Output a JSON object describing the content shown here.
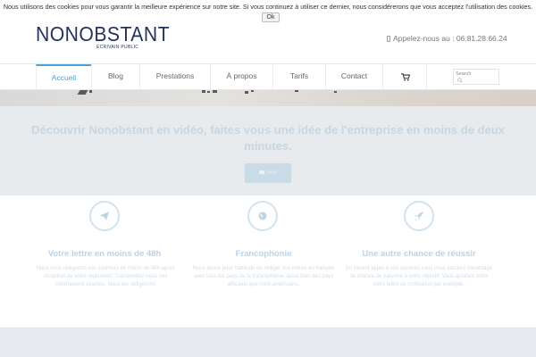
{
  "cookie": {
    "text": "Nous utilisons des cookies pour vous garantir la meilleure expérience sur notre site. Si vous continuez à utiliser ce dernier, nous considérerons que vous acceptez l'utilisation des cookies.",
    "ok_label": "Ok"
  },
  "header": {
    "logo": "NONOBSTANT",
    "logo_sub": "ÉCRIVAIN PUBLIC",
    "phone": "Appelez-nous au : 06.81.28.66.24"
  },
  "nav": {
    "items": [
      {
        "label": "Accueil"
      },
      {
        "label": "Blog"
      },
      {
        "label": "Prestations"
      },
      {
        "label": "À propos"
      },
      {
        "label": "Tarifs"
      },
      {
        "label": "Contact"
      }
    ],
    "active_index": 0,
    "search_placeholder": "Search"
  },
  "hero": {
    "title": "Découvrir Nonobstant en vidéo, faites vous une idée de l'entreprise en moins de deux minutes.",
    "button_label": "Voir"
  },
  "features": [
    {
      "icon": "paper-plane-icon",
      "title": "Votre lettre en moins de 48h",
      "text": "Nous vous rédigeons vos courriers en moins de 48h après réception de votre règlement. Transmettez-nous vos informations exactes. Nous les rédigerons"
    },
    {
      "icon": "globe-icon",
      "title": "Francophonie",
      "text": "Nous avons pour habitude de rédiger nos lettres en français avec tous les pays de la francophonie, aussi bien des pays africains que nord-américains."
    },
    {
      "icon": "rocket-icon",
      "title": "Une autre chance de réussir",
      "text": "En faisant appel à nos services vous vous assurez davantage de chance de parvenir à votre objectif. Vous ajoutant entre votre lettre de motivation par exemple."
    }
  ],
  "colors": {
    "brand": "#23335a",
    "accent": "#4aa3d8"
  }
}
